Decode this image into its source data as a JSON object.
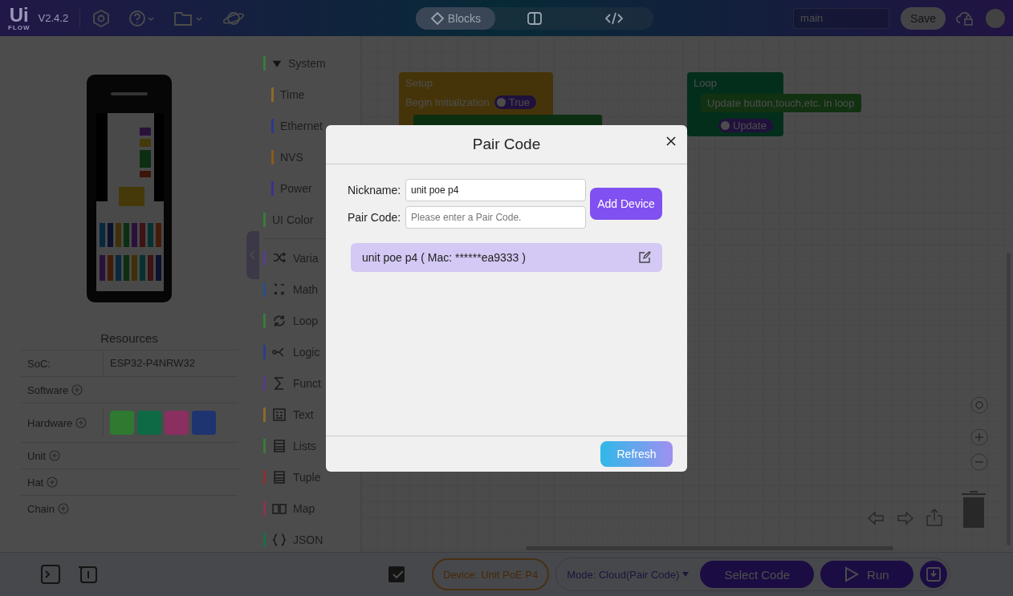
{
  "top_bar": {
    "logo": "Ui",
    "logo_sub": "FLOW",
    "version": "V2.4.2",
    "view_tabs": [
      {
        "kind": "blocks",
        "label": "Blocks",
        "selected": true
      },
      {
        "kind": "split",
        "selected": false
      },
      {
        "kind": "code",
        "selected": false
      }
    ],
    "branch": "main",
    "save": "Save"
  },
  "resources": {
    "title": "Resources",
    "rows": [
      {
        "kind": "value",
        "label": "SoC:",
        "value": "ESP32-P4NRW32"
      },
      {
        "kind": "add",
        "label": "Software"
      },
      {
        "kind": "chips",
        "label": "Hardware",
        "chips": [
          {
            "color": "#2e7a30"
          },
          {
            "color": "#0e6a44"
          },
          {
            "color": "#8a2f60"
          },
          {
            "color": "#1e3470"
          }
        ]
      },
      {
        "kind": "add",
        "label": "Unit"
      },
      {
        "kind": "add",
        "label": "Hat"
      },
      {
        "kind": "add",
        "label": "Chain"
      }
    ]
  },
  "categories": [
    {
      "kind": "group",
      "label": "System",
      "color": "#3a7a3e",
      "expanded": true,
      "children": [
        {
          "label": "Time",
          "color": "#8a6a2a"
        },
        {
          "label": "Ethernet",
          "color": "#2a3a8a"
        },
        {
          "label": "NVS",
          "color": "#8a5a1a"
        },
        {
          "label": "Power",
          "color": "#3a3288"
        }
      ]
    },
    {
      "label": "UI Color",
      "color": "#3a7a3e"
    },
    {
      "kind": "variables",
      "label": "Varia",
      "color": "#5a3e8a"
    },
    {
      "kind": "math",
      "label": "Math",
      "color": "#2a4e88"
    },
    {
      "kind": "loops",
      "label": "Loop",
      "color": "#3a7a3e"
    },
    {
      "kind": "logic",
      "label": "Logic",
      "color": "#2a3e86"
    },
    {
      "kind": "functions",
      "label": "Funct",
      "color": "#523c88"
    },
    {
      "kind": "text",
      "label": "Text",
      "color": "#8a6a2a"
    },
    {
      "kind": "lists",
      "label": "Lists",
      "color": "#3a7a3e"
    },
    {
      "kind": "tuple",
      "label": "Tuple",
      "color": "#8a3232"
    },
    {
      "kind": "map",
      "label": "Map",
      "color": "#8a3256"
    },
    {
      "kind": "json",
      "label": "JSON",
      "color": "#1a6e42"
    }
  ],
  "blocks": [
    {
      "kind": "setup",
      "title": "Setup",
      "label": "Begin Initialization",
      "toggle": "True"
    },
    {
      "kind": "loop",
      "title": "Loop",
      "statement": "Update button,touch,etc. in loop",
      "toggle": "Update"
    }
  ],
  "bottom_bar": {
    "device_label": "Device:",
    "device": "Unit PoE P4",
    "mode_label": "Mode:",
    "mode": "Cloud(Pair Code)",
    "select_code": "Select Code",
    "run": "Run"
  },
  "dialog": {
    "title": "Pair Code",
    "fields": [
      {
        "label": "Nickname:",
        "value": "unit poe p4"
      },
      {
        "label": "Pair Code:",
        "placeholder": "Please enter a Pair Code."
      }
    ],
    "add_button": "Add Device",
    "devices": [
      {
        "name": "unit poe p4 ( Mac: ******ea9333 )"
      }
    ],
    "refresh": "Refresh"
  }
}
